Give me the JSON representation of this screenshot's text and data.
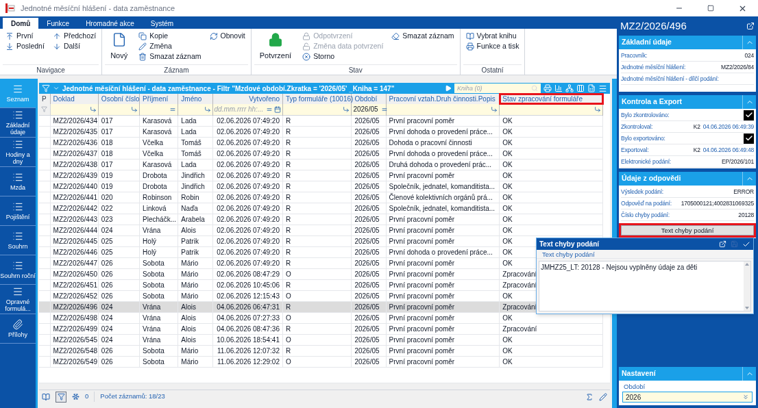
{
  "window": {
    "title": "Jednotné měsíční hlášení - data zaměstnance"
  },
  "tabs": [
    {
      "label": "Domů",
      "selected": true
    },
    {
      "label": "Funkce",
      "selected": false
    },
    {
      "label": "Hromadné akce",
      "selected": false
    },
    {
      "label": "Systém",
      "selected": false
    }
  ],
  "ribbon": {
    "groups": [
      {
        "label": "Navigace",
        "columns": [
          [
            {
              "label": "První",
              "kind": "small",
              "disabled": false
            },
            {
              "label": "Poslední",
              "kind": "small",
              "disabled": false
            }
          ],
          [
            {
              "label": "Předchozí",
              "kind": "small",
              "disabled": false
            },
            {
              "label": "Další",
              "kind": "small",
              "disabled": false
            }
          ]
        ]
      },
      {
        "label": "Záznam",
        "columns": [
          [
            {
              "label": "Nový",
              "kind": "large",
              "disabled": false
            }
          ],
          [
            {
              "label": "Kopie",
              "kind": "small",
              "disabled": false
            },
            {
              "label": "Změna",
              "kind": "small",
              "disabled": false
            },
            {
              "label": "Smazat záznam",
              "kind": "small",
              "disabled": false
            }
          ],
          [
            {
              "label": "Obnovit",
              "kind": "small",
              "disabled": false
            }
          ]
        ]
      },
      {
        "label": "Stav",
        "columns": [
          [
            {
              "label": "Potvrzení",
              "kind": "large",
              "disabled": false
            }
          ],
          [
            {
              "label": "Odpotvrzení",
              "kind": "small",
              "disabled": true
            },
            {
              "label": "Změna data potvrzení",
              "kind": "small",
              "disabled": true
            },
            {
              "label": "Storno",
              "kind": "small",
              "disabled": false
            }
          ],
          [
            {
              "label": "Smazat záznam",
              "kind": "small",
              "disabled": false
            }
          ]
        ]
      },
      {
        "label": "Ostatní",
        "columns": [
          [
            {
              "label": "Vybrat knihu",
              "kind": "small",
              "disabled": false
            },
            {
              "label": "Funkce a tisk",
              "kind": "small",
              "disabled": false
            }
          ]
        ]
      }
    ]
  },
  "nav": [
    {
      "label": "Seznam",
      "selected": true
    },
    {
      "label": "Základní údaje",
      "selected": false
    },
    {
      "label": "Hodiny a dny",
      "selected": false
    },
    {
      "label": "Mzda",
      "selected": false
    },
    {
      "label": "Pojištění",
      "selected": false
    },
    {
      "label": "Souhrn",
      "selected": false
    },
    {
      "label": "Souhrn roční",
      "selected": false
    },
    {
      "label": "Opravné formulá...",
      "selected": false
    },
    {
      "label": "Přílohy",
      "selected": false
    }
  ],
  "grid": {
    "title": "Jednotné měsíční hlášení - data zaměstnance - Filtr \"Mzdové období.Zkratka = '2026/05' _Kniha = 147\"",
    "search_placeholder": "Kniha (0)",
    "columns": [
      {
        "label": "P"
      },
      {
        "label": "Doklad"
      },
      {
        "label": "Osobní číslo"
      },
      {
        "label": "Příjmení"
      },
      {
        "label": "Jméno"
      },
      {
        "label": "Vytvořeno",
        "filter_placeholder": "dd.mm.rrrr hh:..."
      },
      {
        "label": "Typ formuláře (10016)"
      },
      {
        "label": "Období",
        "filter_value": "2026/05"
      },
      {
        "label": "Pracovní vztah.Druh činnosti.Popis"
      },
      {
        "label": "Stav zpracování formuláře",
        "highlighted": true
      }
    ],
    "rows": [
      {
        "selected": false,
        "cells": [
          "",
          "MZ2/2026/434",
          "017",
          "Karasová",
          "Lada",
          "02.06.2026 07:49:20",
          "R",
          "2026/05",
          "První pracovní poměr",
          "OK"
        ]
      },
      {
        "selected": false,
        "cells": [
          "",
          "MZ2/2026/435",
          "017",
          "Karasová",
          "Lada",
          "02.06.2026 07:49:20",
          "R",
          "2026/05",
          "První dohoda o provedení práce...",
          "OK"
        ]
      },
      {
        "selected": false,
        "cells": [
          "",
          "MZ2/2026/436",
          "018",
          "Včelka",
          "Tomáš",
          "02.06.2026 07:49:20",
          "R",
          "2026/05",
          "Dohoda o pracovní činnosti",
          "OK"
        ]
      },
      {
        "selected": false,
        "cells": [
          "",
          "MZ2/2026/437",
          "018",
          "Včelka",
          "Tomáš",
          "02.06.2026 07:49:20",
          "R",
          "2026/05",
          "První dohoda o provedení práce...",
          "OK"
        ]
      },
      {
        "selected": false,
        "cells": [
          "",
          "MZ2/2026/438",
          "017",
          "Karasová",
          "Lada",
          "02.06.2026 07:49:20",
          "R",
          "2026/05",
          "Druhá dohoda o provedení prác...",
          "OK"
        ]
      },
      {
        "selected": false,
        "cells": [
          "",
          "MZ2/2026/439",
          "019",
          "Drobota",
          "Jindřich",
          "02.06.2026 07:49:20",
          "R",
          "2026/05",
          "První pracovní poměr",
          "OK"
        ]
      },
      {
        "selected": false,
        "cells": [
          "",
          "MZ2/2026/440",
          "019",
          "Drobota",
          "Jindřich",
          "02.06.2026 07:49:20",
          "R",
          "2026/05",
          "Společník, jednatel, komanditista...",
          "OK"
        ]
      },
      {
        "selected": false,
        "cells": [
          "",
          "MZ2/2026/441",
          "020",
          "Robinson",
          "Robin",
          "02.06.2026 07:49:20",
          "R",
          "2026/05",
          "Členové kolektivních orgánů prá...",
          "OK"
        ]
      },
      {
        "selected": false,
        "cells": [
          "",
          "MZ2/2026/442",
          "022",
          "Linková",
          "Naďa",
          "02.06.2026 07:49:20",
          "R",
          "2026/05",
          "Společník, jednatel, komanditista...",
          "OK"
        ]
      },
      {
        "selected": false,
        "cells": [
          "",
          "MZ2/2026/443",
          "023",
          "Plecháčk...",
          "Arabela",
          "02.06.2026 07:49:20",
          "R",
          "2026/05",
          "První pracovní poměr",
          "OK"
        ]
      },
      {
        "selected": false,
        "cells": [
          "",
          "MZ2/2026/444",
          "024",
          "Vrána",
          "Alois",
          "02.06.2026 07:49:20",
          "R",
          "2026/05",
          "První pracovní poměr",
          "OK"
        ]
      },
      {
        "selected": false,
        "cells": [
          "",
          "MZ2/2026/445",
          "025",
          "Holý",
          "Patrik",
          "02.06.2026 07:49:20",
          "R",
          "2026/05",
          "První pracovní poměr",
          "OK"
        ]
      },
      {
        "selected": false,
        "cells": [
          "",
          "MZ2/2026/446",
          "025",
          "Holý",
          "Patrik",
          "02.06.2026 07:49:20",
          "R",
          "2026/05",
          "První dohoda o provedení práce...",
          "OK"
        ]
      },
      {
        "selected": false,
        "cells": [
          "",
          "MZ2/2026/447",
          "026",
          "Sobota",
          "Mário",
          "02.06.2026 07:49:20",
          "R",
          "2026/05",
          "První pracovní poměr",
          "OK"
        ]
      },
      {
        "selected": false,
        "cells": [
          "",
          "MZ2/2026/450",
          "026",
          "Sobota",
          "Mário",
          "02.06.2026 08:47:29",
          "O",
          "2026/05",
          "První pracovní poměr",
          "Zpracování"
        ]
      },
      {
        "selected": false,
        "cells": [
          "",
          "MZ2/2026/451",
          "026",
          "Sobota",
          "Mário",
          "02.06.2026 10:45:06",
          "R",
          "2026/05",
          "První pracovní poměr",
          "Zpracování"
        ]
      },
      {
        "selected": false,
        "cells": [
          "",
          "MZ2/2026/452",
          "026",
          "Sobota",
          "Mário",
          "02.06.2026 12:15:43",
          "O",
          "2026/05",
          "První pracovní poměr",
          "OK"
        ]
      },
      {
        "selected": true,
        "cells": [
          "",
          "MZ2/2026/496",
          "024",
          "Vrána",
          "Alois",
          "04.06.2026 06:47:31",
          "R",
          "2026/05",
          "První pracovní poměr",
          "Zpracování"
        ]
      },
      {
        "selected": false,
        "cells": [
          "",
          "MZ2/2026/498",
          "024",
          "Vrána",
          "Alois",
          "04.06.2026 07:27:33",
          "O",
          "2026/05",
          "První pracovní poměr",
          "OK"
        ]
      },
      {
        "selected": false,
        "cells": [
          "",
          "MZ2/2026/499",
          "024",
          "Vrána",
          "Alois",
          "04.06.2026 08:47:36",
          "R",
          "2026/05",
          "První pracovní poměr",
          "Zpracování"
        ]
      },
      {
        "selected": false,
        "cells": [
          "",
          "MZ2/2026/545",
          "024",
          "Vrána",
          "Alois",
          "10.06.2026 18:54:41",
          "O",
          "2026/05",
          "První pracovní poměr",
          "OK"
        ]
      },
      {
        "selected": false,
        "cells": [
          "",
          "MZ2/2026/548",
          "026",
          "Sobota",
          "Mário",
          "11.06.2026 12:07:32",
          "R",
          "2026/05",
          "První pracovní poměr",
          "OK"
        ]
      },
      {
        "selected": false,
        "cells": [
          "",
          "MZ2/2026/549",
          "026",
          "Sobota",
          "Mário",
          "11.06.2026 12:29:02",
          "O",
          "2026/05",
          "První pracovní poměr",
          "OK"
        ]
      }
    ]
  },
  "status_bar": {
    "count": "0",
    "records": "Počet záznamů: 18/23"
  },
  "detail": {
    "title": "MZ2/2026/496",
    "sections": [
      {
        "title": "Základní údaje",
        "expanded": true,
        "fields": [
          {
            "kind": "text",
            "label": "Pracovník:",
            "value": "024"
          },
          {
            "kind": "text",
            "label": "Jednotné měsíční hlášení:",
            "value": "MZ2/2026/84"
          },
          {
            "kind": "text",
            "label": "Jednotné měsíční hlášení - dílčí podání:"
          }
        ]
      },
      {
        "title": "Kontrola a Export",
        "expanded": true,
        "fields": [
          {
            "kind": "check",
            "label": "Bylo zkontrolováno:",
            "checked": true
          },
          {
            "kind": "stamp",
            "label": "Zkontroloval:",
            "user": "K2",
            "date": "04.06.2026 06:49:39"
          },
          {
            "kind": "check",
            "label": "Bylo exportováno:",
            "checked": true
          },
          {
            "kind": "stamp",
            "label": "Exportoval:",
            "user": "K2",
            "date": "04.06.2026 06:49:48"
          },
          {
            "kind": "text",
            "label": "Elektronické podání:",
            "value": "EP/2026/101"
          }
        ]
      },
      {
        "title": "Údaje z odpovědi",
        "expanded": true,
        "fields": [
          {
            "kind": "text",
            "label": "Výsledek podání:",
            "value": "ERROR"
          },
          {
            "kind": "text",
            "label": "Odpověď na podání:",
            "value": "1705000121;4002831069325"
          },
          {
            "kind": "text",
            "label": "Číslo chyby podání:",
            "value": "20128"
          }
        ],
        "button": "Text chyby podání"
      }
    ],
    "settings": {
      "title": "Nastavení",
      "expanded": true,
      "field_label": "Období",
      "field_value": "2026"
    }
  },
  "popup": {
    "title": "Text chyby podání",
    "field_label": "Text chyby podání",
    "text": "JMHZ25_LT: 20128 - Nejsou vyplněny údaje za děti"
  }
}
